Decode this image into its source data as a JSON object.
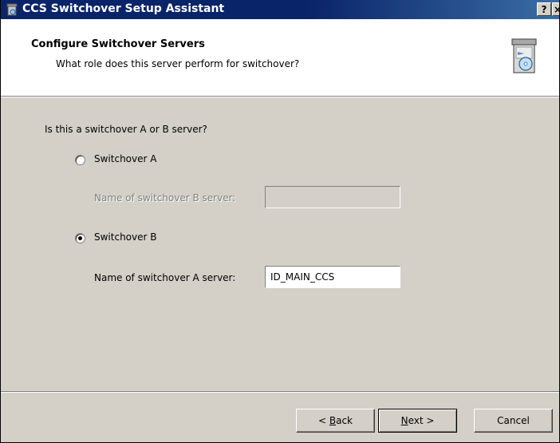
{
  "window": {
    "title": "CCS Switchover Setup Assistant",
    "help_label": "?",
    "close_label": "×"
  },
  "header": {
    "title": "Configure Switchover Servers",
    "subtitle": "What role does this server perform for switchover?"
  },
  "main": {
    "question": "Is this a switchover A or B server?",
    "option_a": {
      "label": "Switchover A",
      "selected": false,
      "field_label": "Name of switchover B server:",
      "field_value": "",
      "enabled": false
    },
    "option_b": {
      "label": "Switchover B",
      "selected": true,
      "field_label": "Name of switchover A server:",
      "field_value": "ID_MAIN_CCS",
      "enabled": true
    }
  },
  "buttons": {
    "back": {
      "prefix": "< ",
      "accel": "B",
      "rest": "ack"
    },
    "next": {
      "accel": "N",
      "rest": "ext >"
    },
    "cancel": "Cancel"
  },
  "icons": {
    "app": "setup-wizard-icon",
    "header": "setup-box-cd-icon"
  },
  "colors": {
    "title_bar": "#0a246a",
    "dialog_bg": "#d4d0c8",
    "header_bg": "#ffffff"
  }
}
